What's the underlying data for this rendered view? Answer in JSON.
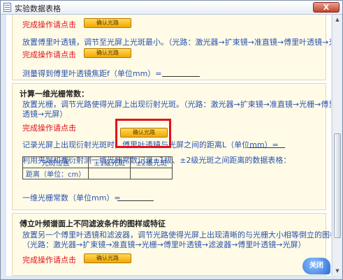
{
  "window": {
    "title": "实验数据表格",
    "close_label": "X"
  },
  "section1": {
    "confirm_prompt_1": "完成操作请点击",
    "confirm_prompt_2": "完成操作请点击",
    "instruction": "放置傅里叶透镜，调节至光屏上光斑最小。（光路：激光器→扩束镜→准直镜→傅里叶透镜→光屏）",
    "measure_label": "测量得到傅里叶透镜焦距f（单位mm）="
  },
  "section2": {
    "heading": "计算一维光栅常数：",
    "instruction_line1": "放置光栅，调节光路使得光屏上出现衍射光斑。（光路：激光器→扩束镜→准直镜→光栅→傅里叶",
    "instruction_line2": "透镜→光屏）",
    "confirm_prompt": "完成操作请点击",
    "distance_label": "记录光屏上出现衍射光斑时，傅里叶透镜与光屏之间的距离L（单位mm）=",
    "table_intro": "利用夹垠和费衍射测一维光栅常数记录±1级、±2级光斑之间距离的数据表格：",
    "table": {
      "headers": [
        "光斑位置",
        "±1级光斑",
        "±2级光斑"
      ],
      "rows": [
        [
          "距离（单位：cm）",
          "",
          ""
        ]
      ]
    },
    "constant_label": "一维光栅常数（单位mm）="
  },
  "section3": {
    "heading": "傅立叶频谱面上不同滤波条件的图样或特征",
    "instruction_line1": "放置另一个傅里叶透镜和滤波器，调节光路使得光屏上出现清晰的与光栅大小相等倒立的图样。",
    "instruction_line2": "（光路：激光器→扩束镜→准直镜→光栅→傅里叶透镜→滤波器→傅里叶透镜→光屏）",
    "confirm_prompt": "完成操作请点击"
  },
  "buttons": {
    "confirm_light_path": "确认光路"
  },
  "logo_text": "关闭",
  "colors": {
    "prompt_red": "#e0101a",
    "text_blue": "#2a52b0",
    "button_orange": "#f2a800",
    "panel_bg": "#fffbe6"
  }
}
